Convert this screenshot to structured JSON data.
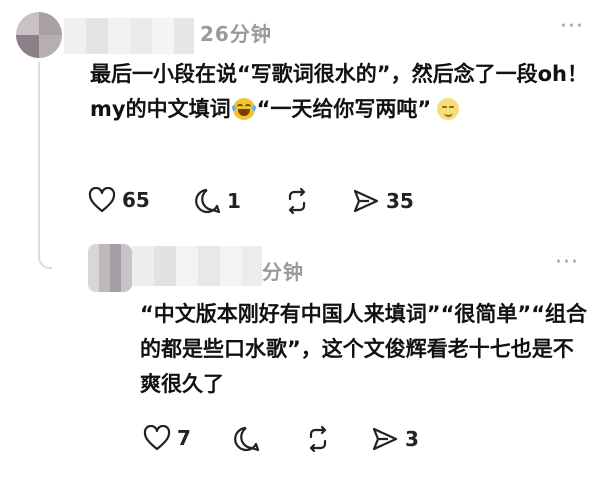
{
  "comments": [
    {
      "time": "26分钟",
      "more": "···",
      "text_parts": [
        "最后一小段在说“写歌词很水的”，然后念了一段oh！my的中文填词",
        "“一天给你写两吨”"
      ],
      "emojis": [
        "laughing-with-tears",
        "smirking-face"
      ],
      "likes": "65",
      "replies": "1",
      "reposts": "",
      "shares": "35"
    },
    {
      "time": "分钟",
      "more": "···",
      "text": "“中文版本刚好有中国人来填词”“很简单”“组合的都是些口水歌”，这个文俊辉看老十七也是不爽很久了",
      "likes": "7",
      "replies": "",
      "reposts": "",
      "shares": "3"
    }
  ],
  "colors": {
    "text": "#111111",
    "meta": "#9a9a9a",
    "thread_line": "#dcdcdc"
  },
  "icons": [
    "heart-icon",
    "reply-bubble-icon",
    "repost-icon",
    "share-send-icon",
    "more-icon"
  ]
}
